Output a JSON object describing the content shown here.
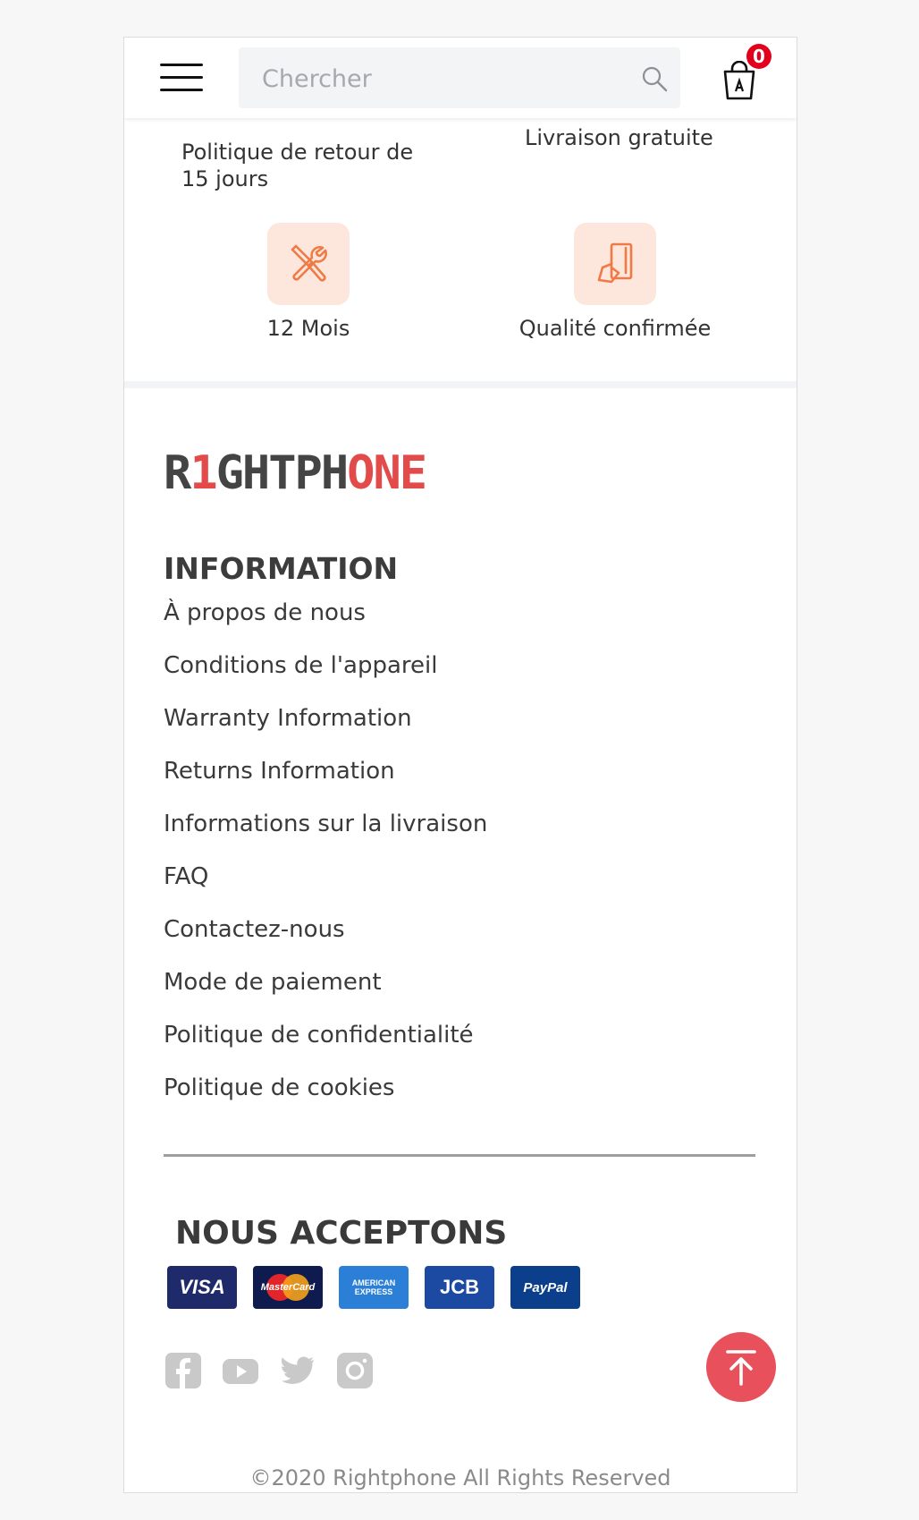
{
  "header": {
    "search_placeholder": "Chercher",
    "cart_count": "0"
  },
  "features": {
    "top_left_line1": "Politique de retour de",
    "top_left_line2": "15 jours",
    "top_right": "Livraison gratuite",
    "items": [
      {
        "icon": "tools-icon",
        "label": "12 Mois"
      },
      {
        "icon": "quality-icon",
        "label": "Qualité confirmée"
      }
    ]
  },
  "logo": {
    "part1": "R",
    "part2": "1",
    "part3": "GHTPH",
    "part4": "ONE"
  },
  "information": {
    "title": "INFORMATION",
    "links": [
      "À propos de nous",
      "Conditions de l'appareil",
      "Warranty Information",
      "Returns Information",
      "Informations sur la livraison",
      "FAQ",
      "Contactez-nous",
      "Mode de paiement",
      "Politique de confidentialité",
      "Politique de cookies"
    ]
  },
  "payments": {
    "title": "NOUS ACCEPTONS",
    "cards": [
      "VISA",
      "MasterCard",
      "AMERICAN EXPRESS",
      "JCB",
      "PayPal"
    ]
  },
  "social": [
    "facebook-icon",
    "youtube-icon",
    "twitter-icon",
    "instagram-icon"
  ],
  "footer": {
    "copyright": "©2020 Rightphone All Rights Reserved"
  },
  "colors": {
    "accent_red": "#e2001a",
    "logo_red": "#e34a4a",
    "icon_orange": "#f07a45",
    "icon_bg": "#fde6db",
    "totop_bg": "#e8505b"
  }
}
